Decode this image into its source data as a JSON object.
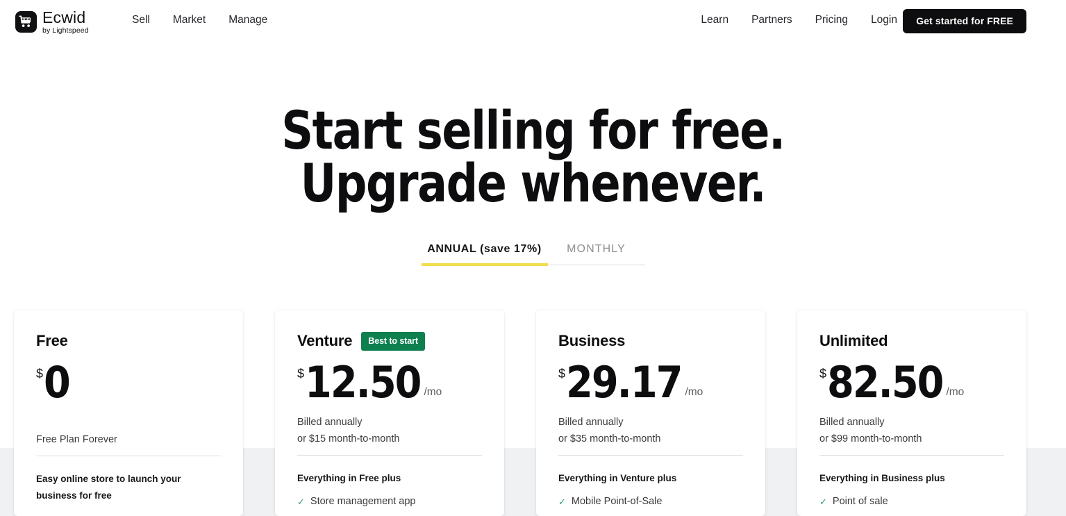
{
  "header": {
    "logo": {
      "name": "Ecwid",
      "sub": "by Lightspeed",
      "icon": "shopping-cart-icon"
    },
    "nav_left": [
      {
        "label": "Sell"
      },
      {
        "label": "Market"
      },
      {
        "label": "Manage"
      }
    ],
    "nav_right": [
      {
        "label": "Learn"
      },
      {
        "label": "Partners"
      },
      {
        "label": "Pricing"
      },
      {
        "label": "Login"
      }
    ],
    "cta_label": "Get started for FREE"
  },
  "hero": {
    "line1": "Start selling for free.",
    "line2": "Upgrade whenever."
  },
  "billing_toggle": {
    "annual_label": "ANNUAL (save 17%)",
    "monthly_label": "MONTHLY",
    "active": "annual",
    "active_underline_color": "#f2dd4e"
  },
  "plans": [
    {
      "name": "Free",
      "badge": null,
      "currency": "$",
      "price": "0",
      "per": "",
      "billing_line1": "Free Plan Forever",
      "billing_line2": "",
      "features_heading": "Easy online store to launch your business for free",
      "features": []
    },
    {
      "name": "Venture",
      "badge": "Best to start",
      "currency": "$",
      "price": "12.50",
      "per": "/mo",
      "billing_line1": "Billed annually",
      "billing_line2": "or $15 month-to-month",
      "features_heading": "Everything in Free plus",
      "features": [
        "Store management app"
      ]
    },
    {
      "name": "Business",
      "badge": null,
      "currency": "$",
      "price": "29.17",
      "per": "/mo",
      "billing_line1": "Billed annually",
      "billing_line2": "or $35 month-to-month",
      "features_heading": "Everything in Venture plus",
      "features": [
        "Mobile Point-of-Sale"
      ]
    },
    {
      "name": "Unlimited",
      "badge": null,
      "currency": "$",
      "price": "82.50",
      "per": "/mo",
      "billing_line1": "Billed annually",
      "billing_line2": "or $99 month-to-month",
      "features_heading": "Everything in Business plus",
      "features": [
        "Point of sale"
      ]
    }
  ],
  "colors": {
    "brand_black": "#0d0d0f",
    "badge_green": "#0e8050",
    "check_green": "#2f9e6b",
    "highlight_yellow": "#f2dd4e",
    "band_gray": "#f0f1f3"
  }
}
